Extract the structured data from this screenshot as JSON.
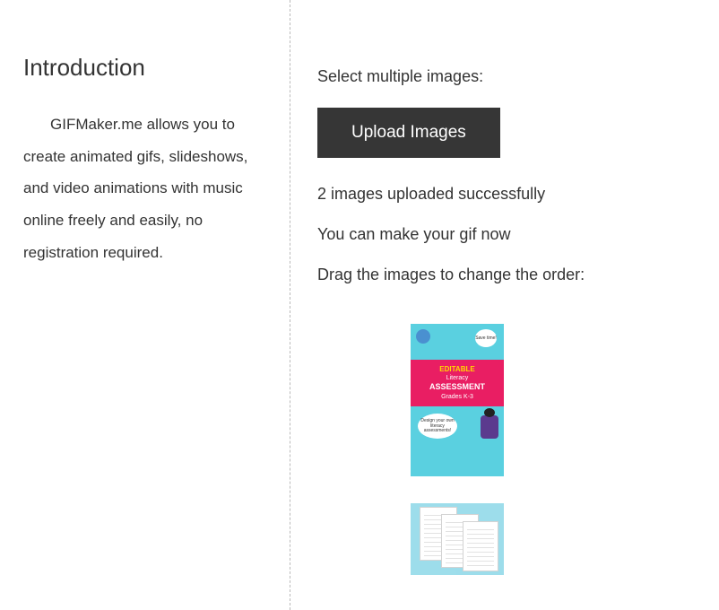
{
  "left": {
    "heading": "Introduction",
    "paragraph": "GIFMaker.me allows you to create animated gifs, slideshows, and video animations with music online freely and easily, no registration required."
  },
  "right": {
    "select_label": "Select multiple images:",
    "upload_button": "Upload Images",
    "status": "2 images uploaded successfully",
    "hint": "You can make your gif now",
    "drag_label": "Drag the images to change the order:"
  },
  "thumb1": {
    "bubble_top": "Save time!",
    "line1": "EDITABLE",
    "line2": "Literacy",
    "line3": "ASSESSMENT",
    "line4": "Grades K-3",
    "bubble_bottom": "Design your own literacy assessments!"
  }
}
